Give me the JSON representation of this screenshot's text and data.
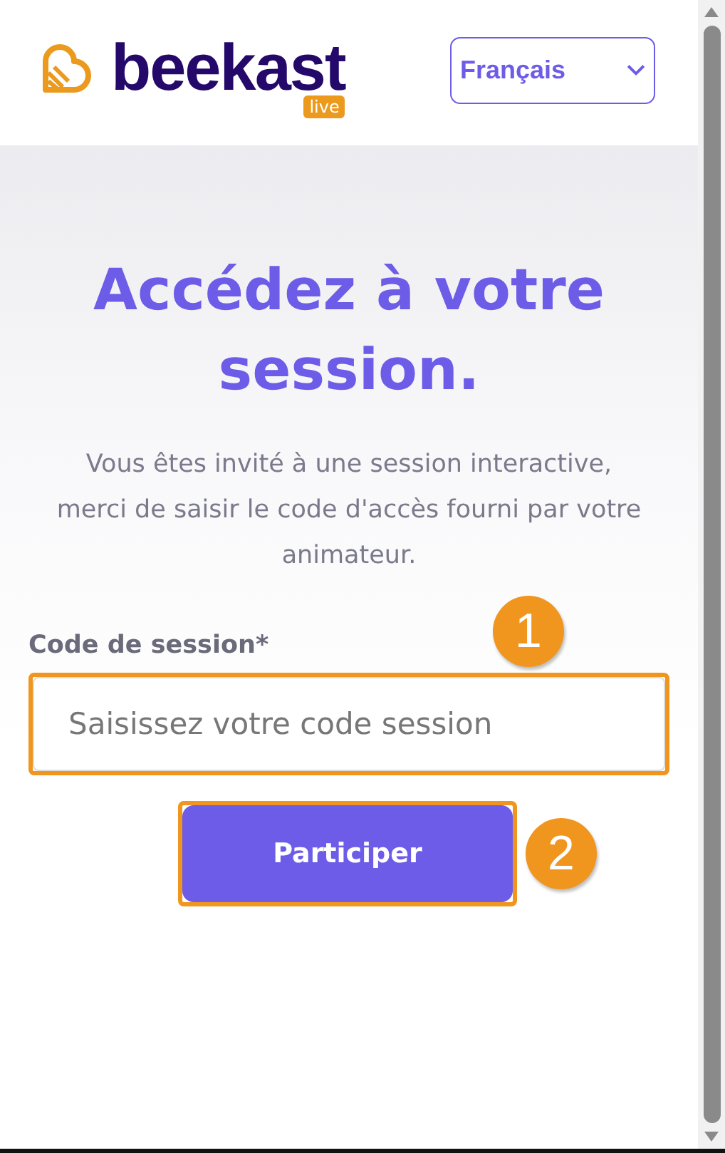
{
  "header": {
    "logo": {
      "wordmark": "beekast",
      "badge": "live"
    },
    "language_select": {
      "value": "Français"
    }
  },
  "hero": {
    "title": "Accédez à votre session.",
    "description": "Vous êtes invité à une session interactive, merci de saisir le code d'accès fourni par votre animateur."
  },
  "form": {
    "label": "Code de session*",
    "field": {
      "placeholder": "Saisissez votre code session",
      "highlighted": true
    },
    "submit": {
      "label": "Participer",
      "highlighted": true
    }
  },
  "callouts": [
    "1",
    "2"
  ]
}
